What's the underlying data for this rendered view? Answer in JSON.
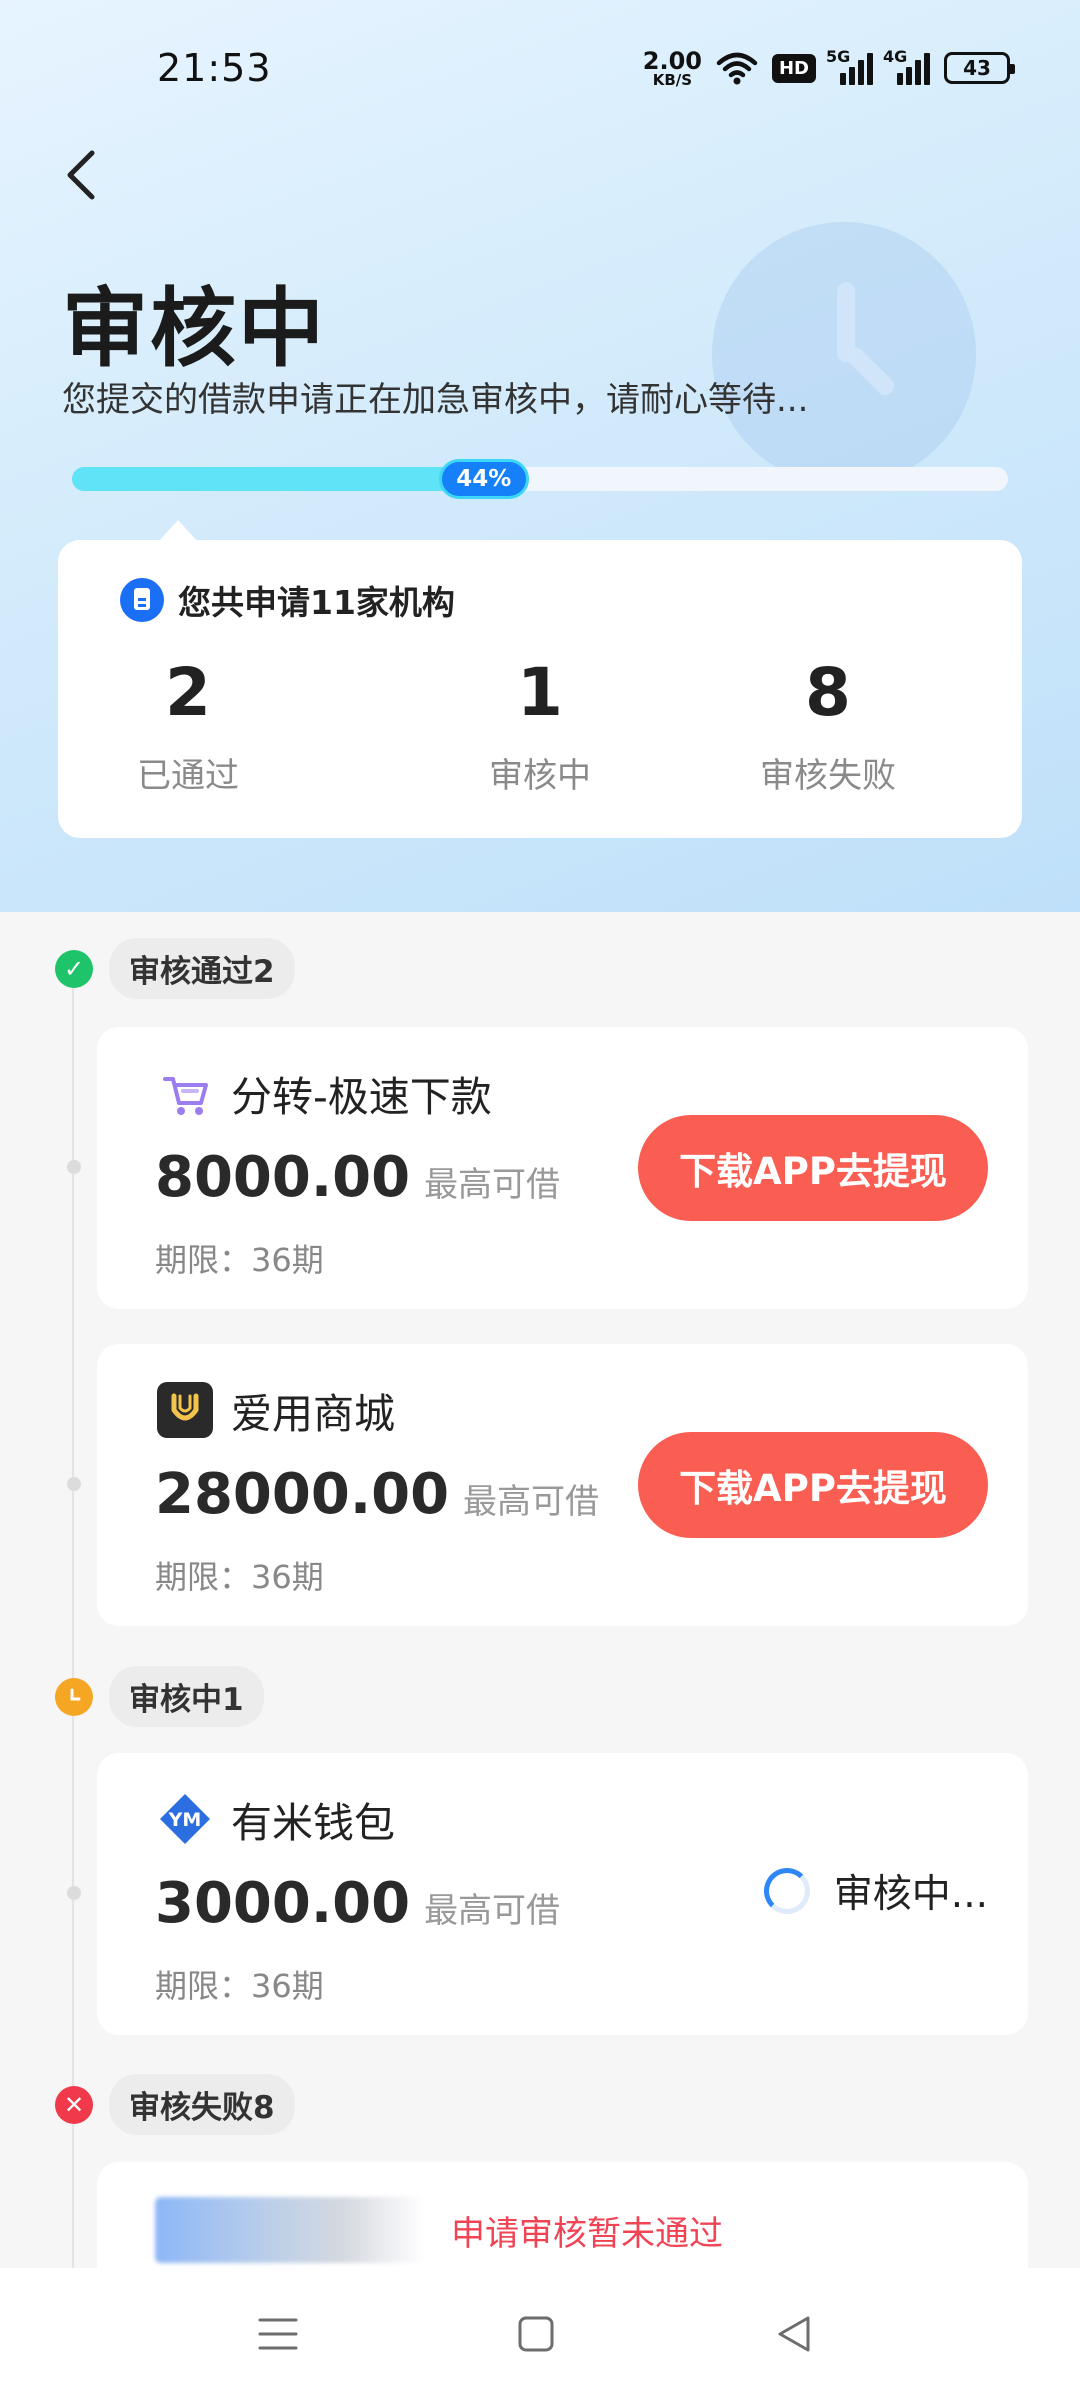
{
  "status_bar": {
    "time": "21:53",
    "net_speed_value": "2.00",
    "net_speed_unit": "KB/S",
    "hd_badge": "HD",
    "signal1_label": "5G",
    "signal2_label": "4G",
    "battery": "43"
  },
  "header": {
    "back_icon": "chevron-left-icon",
    "title": "审核中",
    "subtitle": "您提交的借款申请正在加急审核中，请耐心等待...",
    "progress_percent": 44,
    "progress_label": "44%"
  },
  "summary": {
    "title": "您共申请11家机构",
    "stats": [
      {
        "value": "2",
        "label": "已通过"
      },
      {
        "value": "1",
        "label": "审核中"
      },
      {
        "value": "8",
        "label": "审核失败"
      }
    ]
  },
  "sections": {
    "approved": {
      "label": "审核通过2",
      "color": "#1fc46a"
    },
    "reviewing": {
      "label": "审核中1",
      "color": "#f5a623"
    },
    "failed": {
      "label": "审核失败8",
      "color": "#f0394b"
    }
  },
  "approved_items": [
    {
      "name": "分转-极速下款",
      "amount": "8000.00",
      "amount_label": "最高可借",
      "term": "期限：36期",
      "button": "下载APP去提现",
      "logo": "cart-icon"
    },
    {
      "name": "爱用商城",
      "amount": "28000.00",
      "amount_label": "最高可借",
      "term": "期限：36期",
      "button": "下载APP去提现",
      "logo": "smile-bag-icon"
    }
  ],
  "reviewing_items": [
    {
      "name": "有米钱包",
      "amount": "3000.00",
      "amount_label": "最高可借",
      "term": "期限：36期",
      "status": "审核中...",
      "logo": "ym-diamond-icon"
    }
  ],
  "failed_items": [
    {
      "status": "申请审核暂未通过"
    }
  ],
  "nav": {
    "menu_icon": "menu-icon",
    "home_icon": "square-icon",
    "back_icon": "triangle-back-icon"
  },
  "colors": {
    "accent": "#1680f8",
    "cta": "#fa5e52",
    "progress": "#5ee4f6",
    "fail_text": "#f04455"
  }
}
